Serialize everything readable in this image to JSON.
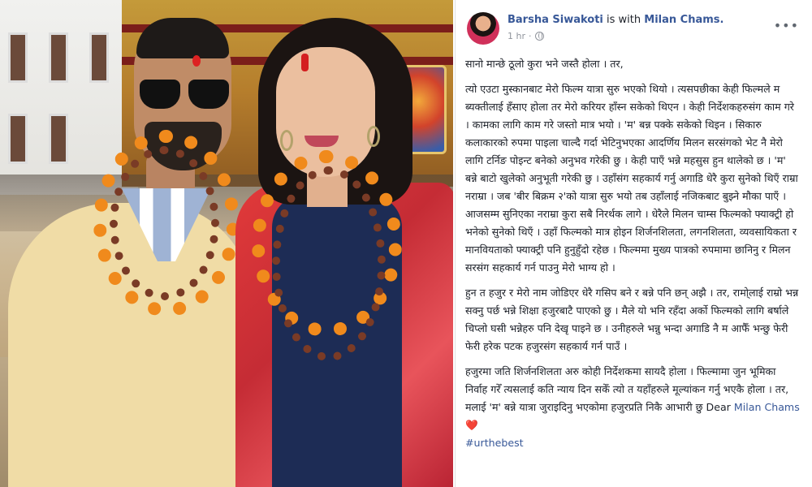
{
  "post": {
    "author": "Barsha Siwakoti",
    "with_text": "is with",
    "tagged": "Milan Chams.",
    "time": "1 hr",
    "time_sep": "·",
    "more_icon": "more-options-icon",
    "privacy_icon": "globe-icon",
    "p1": "सानो मान्छे ठूलो कुरा भने जस्तै होला । तर,",
    "p2": "त्यो एउटा मुस्कानबाट मेरो फिल्म यात्रा सुरु भएको थियो । त्यसपछीका केही फिल्मले म ब्यक्तीलाई हँसाए होला तर मेरो करियर हाँस्न सकेको थिएन । केही निर्देशकहरुसंग काम गरे । कामका लागि काम गरे जस्तो मात्र भयो । 'म' बन्न पक्के सकेको थिइन । सिकारु कलाकारको रुपमा पाइला चाल्दै गर्दा भेटिनुभएका आदर्णिय मिलन सरसंगको भेट नै मेरो लागि टर्निङ पोइन्ट बनेको अनुभव गरेकी छु । केही पाएँ भन्ने महसुस हुन थालेको छ । 'म' बन्ने बाटो खुलेको अनुभूती गरेकी छु । उहाँसंग सहकार्य गर्नु अगाडि धेरै कुरा सुनेको थिएँ राम्रा नराम्रा । जब 'बीर बिक्रम २'को यात्रा सुरु भयो तब उहाँलाई नजिकबाट बुझ्ने मौका पाएँ । आजसम्म सुनिएका नराम्रा कुरा सबै निरर्थक लागे । धेरैले मिलन चाम्स फिल्मको फ्याक्ट्री हो भनेको सुनेको थिएँ । उहाँ फिल्मको मात्र होइन शिर्जनशिलता, लगनशिलता, व्यवसायिकता र मानवियताको फ्याक्ट्री पनि हुनुहुँदो रहेछ । फिल्ममा मुख्य पात्रको रुपमामा छानिनु र मिलन सरसंग सहकार्य गर्न पाउनु मेरो भाग्य हो ।",
    "p3": "हुन त हजुर र मेरो नाम जोडिएर धेरै गसिप बने र बन्ने पनि छन् अझै । तर, रामो्लाई राम्रो भन्न सक्नु पर्छ भन्ने शिक्षा हजुरबाटै पाएको छु । मैले यो भनि रहँदा अर्को फिल्मको लागि बर्षाले चिप्लो घसी भन्नेहरु पनि देखृ पाइने छ । उनीहरुले भन्नु भन्दा अगाडि नै म आफैँ भन्छु फेरी फेरी हरेक पटक हजुरसंग सहकार्य गर्न पाउँ ।",
    "p4_text": "हजुरमा जति शिर्जनशिलता अरु कोही निर्देशकमा सायदै होला । फिल्मामा जुन भूमिका निर्वाह गरेँ त्यसलाई कति न्याय दिन सकेँ त्यो त यहाँहरुले मूल्यांकन गर्नु भएकै होला । तर, मलाई 'म' बन्ने यात्रा जुराइदिनु भएकोमा हजुरप्रति निकै आभारी छु Dear",
    "p4_mention": "Milan Chams",
    "p4_heart": "❤️",
    "hashtag": "#urthebest"
  },
  "photo": {
    "subject": "man-and-woman-with-garlands-photo"
  }
}
